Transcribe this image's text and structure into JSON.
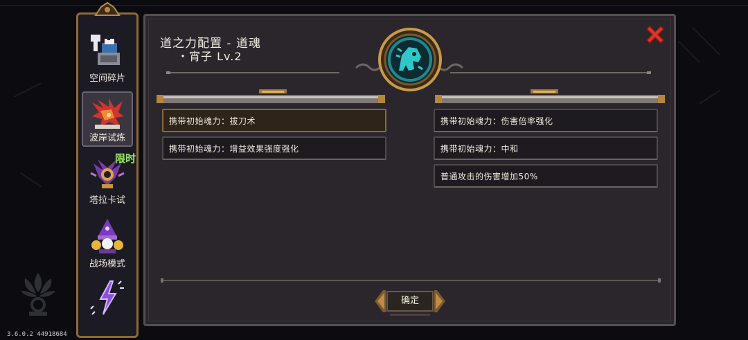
{
  "version": "3.6.0.2 44918684",
  "sidebar": {
    "items": [
      {
        "label": "空间碎片",
        "icon": "space-fragment-icon"
      },
      {
        "label": "波岸试炼",
        "icon": "red-phoenix-icon"
      },
      {
        "label": "塔拉卡试",
        "icon": "taraka-trial-icon",
        "badge": "限时"
      },
      {
        "label": "战场模式",
        "icon": "battlefield-wizard-icon"
      },
      {
        "label": "",
        "icon": "purple-lightning-icon"
      }
    ]
  },
  "panel": {
    "title_line1": "道之力配置 - 道魂",
    "title_line2": "・宵子 Lv.2",
    "left_slots": [
      "携带初始魂力：拔刀术",
      "携带初始魂力：增益效果强度强化"
    ],
    "right_slots": [
      "携带初始魂力：伤害倍率强化",
      "携带初始魂力：中和",
      "普通攻击的伤害增加50%"
    ],
    "confirm_label": "确定"
  },
  "colors": {
    "close": "#e0342a",
    "emblem_ring": "#c99a4a",
    "emblem_core": "#2fc7c9"
  }
}
